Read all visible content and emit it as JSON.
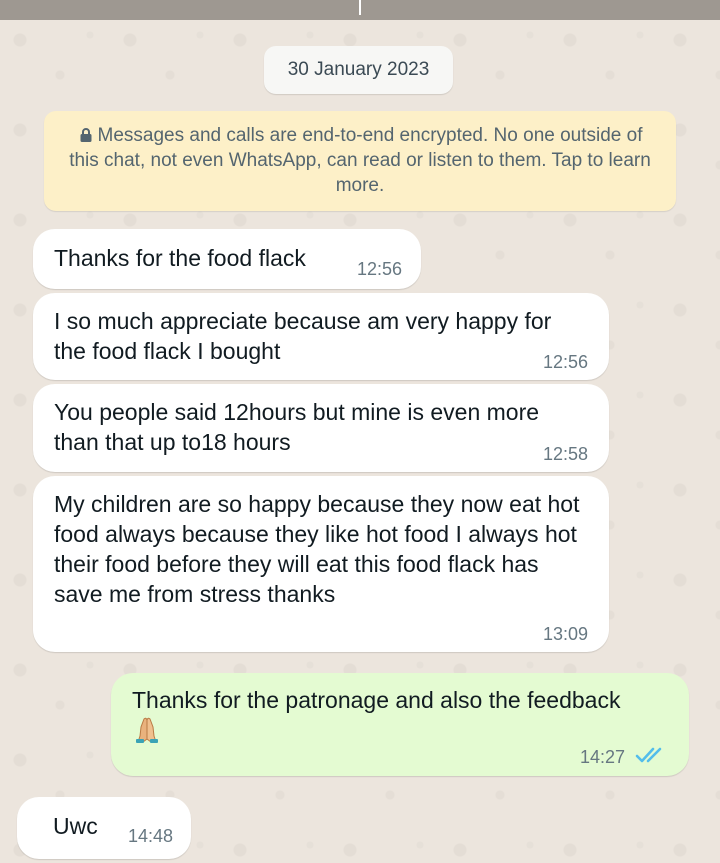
{
  "date_chip": "30 January 2023",
  "encryption_notice": "Messages and calls are end-to-end encrypted. No one outside of this chat, not even WhatsApp, can read or listen to them. Tap to learn more.",
  "messages": [
    {
      "direction": "incoming",
      "text": "Thanks for the food flack",
      "time": "12:56"
    },
    {
      "direction": "incoming",
      "text": "I so much appreciate  because am very happy for the food flack I bought",
      "time": "12:56"
    },
    {
      "direction": "incoming",
      "text": "You people said 12hours but mine is even more than that  up to18 hours",
      "time": "12:58"
    },
    {
      "direction": "incoming",
      "text": "My children are so happy because they now eat hot food always  because they like hot food I always    hot their food before they will eat   this food flack has save me from stress thanks",
      "time": "13:09"
    },
    {
      "direction": "outgoing",
      "text": "Thanks for the patronage and also the feedback",
      "emoji": "folded-hands",
      "time": "14:27",
      "status": "read"
    },
    {
      "direction": "incoming",
      "text": "Uwc",
      "time": "14:48"
    }
  ],
  "colors": {
    "wallpaper": "#ece5dd",
    "incoming_bubble": "#ffffff",
    "outgoing_bubble": "#e4fbd2",
    "encryption_notice_bg": "#fdf0c8",
    "read_tick": "#53bdeb",
    "timestamp": "#667781"
  },
  "icons": {
    "notice": "lock-icon",
    "read_status": "double-check-icon",
    "emoji": "folded-hands-emoji"
  }
}
